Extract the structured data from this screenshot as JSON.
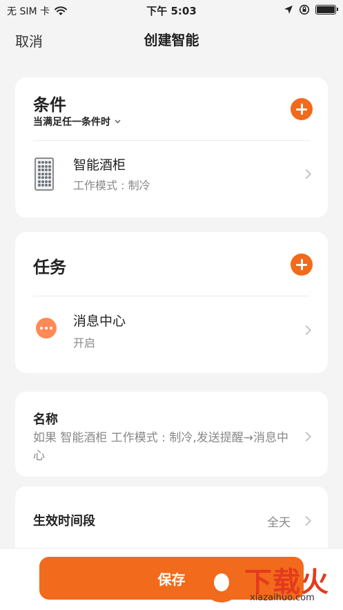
{
  "status_bar": {
    "carrier": "无 SIM 卡",
    "time": "下午 5:03",
    "battery_level": 1.0
  },
  "nav": {
    "cancel_label": "取消",
    "title": "创建智能"
  },
  "conditions": {
    "title": "条件",
    "match_mode": "当满足任一条件时",
    "items": [
      {
        "icon": "wine-cabinet-icon",
        "title": "智能酒柜",
        "subtitle": "工作模式 : 制冷"
      }
    ]
  },
  "tasks": {
    "title": "任务",
    "items": [
      {
        "icon": "message-center-icon",
        "title": "消息中心",
        "subtitle": "开启"
      }
    ]
  },
  "name_section": {
    "label": "名称",
    "value": "如果 智能酒柜 工作模式 : 制冷,发送提醒→消息中心"
  },
  "effective_period": {
    "label": "生效时间段",
    "value": "全天"
  },
  "save_button_label": "保存",
  "watermark": {
    "text": "下载火",
    "url": "xiazaihuo.com"
  },
  "colors": {
    "accent": "#f26a1b",
    "background": "#f4f4f4"
  }
}
